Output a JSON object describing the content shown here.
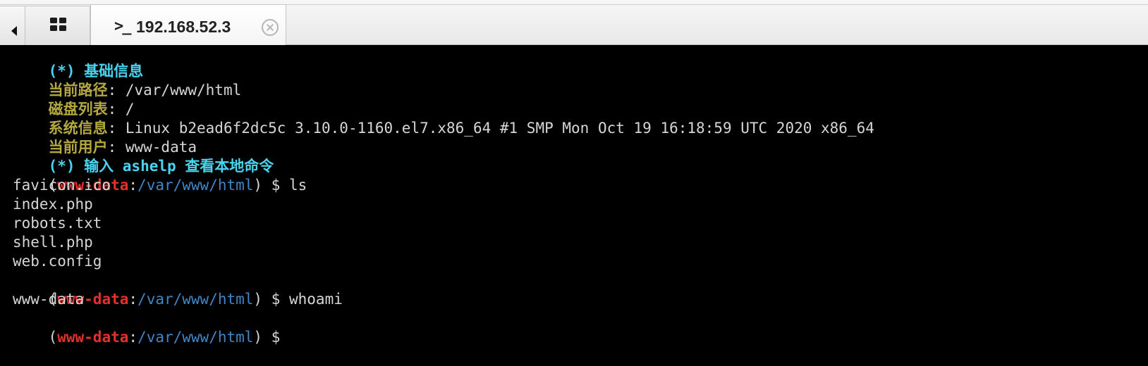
{
  "tabs": {
    "scroll_left_icon": "triangle-left-icon",
    "grid_icon": "grid-icon",
    "active": {
      "prompt_icon": ">_",
      "title": "192.168.52.3",
      "close_icon": "close-circle-icon"
    }
  },
  "terminal": {
    "info_header": "(*) 基础信息",
    "cwd_label": "当前路径",
    "cwd_value": ": /var/www/html",
    "disk_label": "磁盘列表",
    "disk_value": ": /",
    "sysinfo_label": "系统信息",
    "sysinfo_value": ": Linux b2ead6f2dc5c 3.10.0-1160.el7.x86_64 #1 SMP Mon Oct 19 16:18:59 UTC 2020 x86_64",
    "user_label": "当前用户",
    "user_value": ": www-data",
    "help_hint": "(*) 输入 ashelp 查看本地命令",
    "prompt": {
      "open": "(",
      "user": "www-data",
      "sep": ":",
      "path": "/var/www/html",
      "close": ") $ "
    },
    "commands": [
      "ls",
      "whoami",
      ""
    ],
    "ls_output": [
      "favicon.ico",
      "index.php",
      "robots.txt",
      "shell.php",
      "web.config"
    ],
    "whoami_output": "www-data",
    "colors": {
      "background": "#000000",
      "label": "#b4a840",
      "hint": "#49d3ef",
      "user": "#e4302a",
      "path": "#3f86c6",
      "text": "#d6d6d6"
    }
  }
}
